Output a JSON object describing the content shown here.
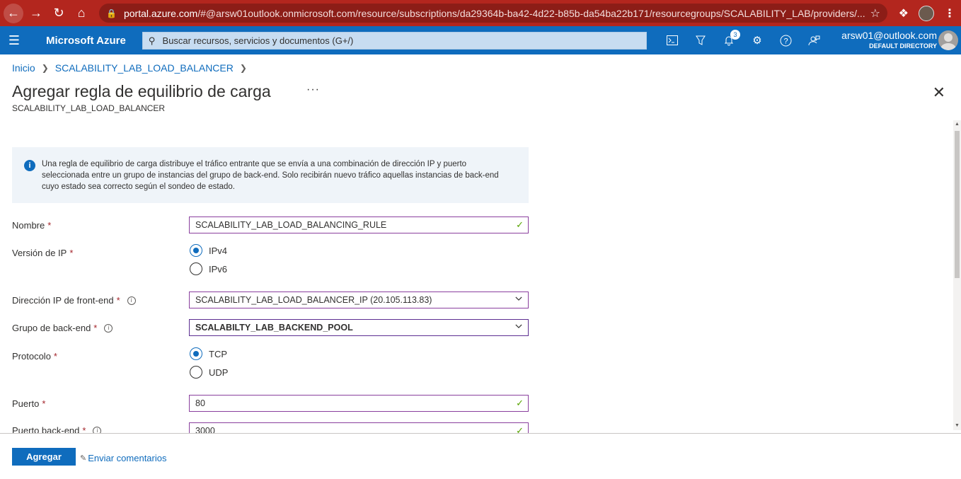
{
  "browser": {
    "url_host": "portal.azure.com",
    "url_rest": "/#@arsw01outlook.onmicrosoft.com/resource/subscriptions/da29364b-ba42-4d22-b85b-da54ba22b171/resourcegroups/SCALABILITY_LAB/providers/..."
  },
  "topbar": {
    "brand": "Microsoft Azure",
    "search_placeholder": "Buscar recursos, servicios y documentos (G+/)",
    "notification_count": "3",
    "account_email": "arsw01@outlook.com",
    "account_directory": "DEFAULT DIRECTORY"
  },
  "breadcrumb": {
    "items": [
      "Inicio",
      "SCALABILITY_LAB_LOAD_BALANCER"
    ]
  },
  "header": {
    "title": "Agregar regla de equilibrio de carga",
    "subtitle": "SCALABILITY_LAB_LOAD_BALANCER"
  },
  "info": {
    "text": "Una regla de equilibrio de carga distribuye el tráfico entrante que se envía a una combinación de dirección IP y puerto seleccionada entre un grupo de instancias del grupo de back-end. Solo recibirán nuevo tráfico aquellas instancias de back-end cuyo estado sea correcto según el sondeo de estado."
  },
  "form": {
    "name_label": "Nombre",
    "name_value": "SCALABILITY_LAB_LOAD_BALANCING_RULE",
    "ipversion_label": "Versión de IP",
    "ipv4": "IPv4",
    "ipv6": "IPv6",
    "frontend_label": "Dirección IP de front-end",
    "frontend_value": "SCALABILITY_LAB_LOAD_BALANCER_IP (20.105.113.83)",
    "backend_label": "Grupo de back-end",
    "backend_value": "SCALABILTY_LAB_BACKEND_POOL",
    "protocol_label": "Protocolo",
    "tcp": "TCP",
    "udp": "UDP",
    "port_label": "Puerto",
    "port_value": "80",
    "backend_port_label": "Puerto back-end",
    "backend_port_value": "3000",
    "required_mark": "*"
  },
  "footer": {
    "add_label": "Agregar",
    "feedback_label": "Enviar comentarios"
  },
  "colors": {
    "azure_blue": "#0f6cbd",
    "chrome_red": "#b3261e",
    "valid_green": "#57a300",
    "required_red": "#a4262c"
  }
}
